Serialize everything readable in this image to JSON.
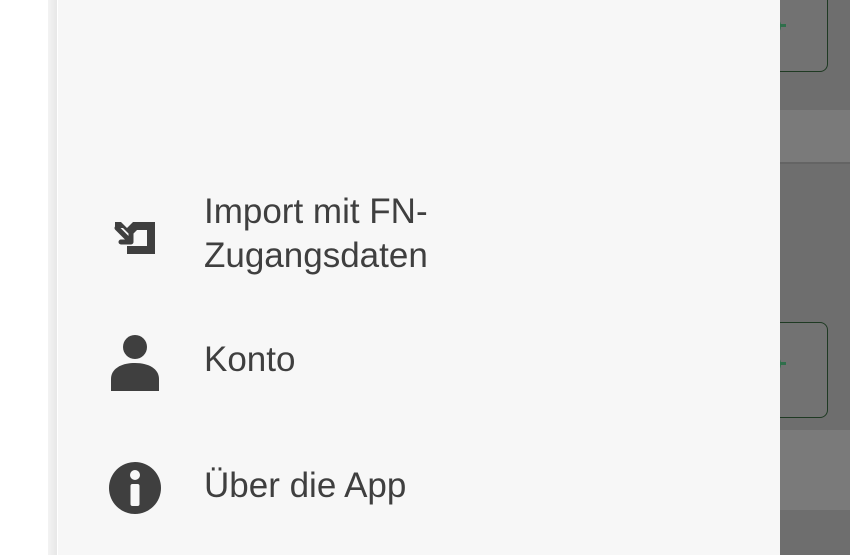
{
  "drawer": {
    "items": [
      {
        "label": "Import mit FN-\nZugangsdaten",
        "icon": "import-icon"
      },
      {
        "label": "Konto",
        "icon": "person-icon"
      },
      {
        "label": "Über die App",
        "icon": "info-icon"
      }
    ]
  },
  "colors": {
    "drawer_background": "#f7f7f7",
    "text": "#3f3f3f",
    "icon": "#3f3f3f",
    "scrim": "#6e6e6e",
    "accent_green": "#2f6f4b"
  }
}
